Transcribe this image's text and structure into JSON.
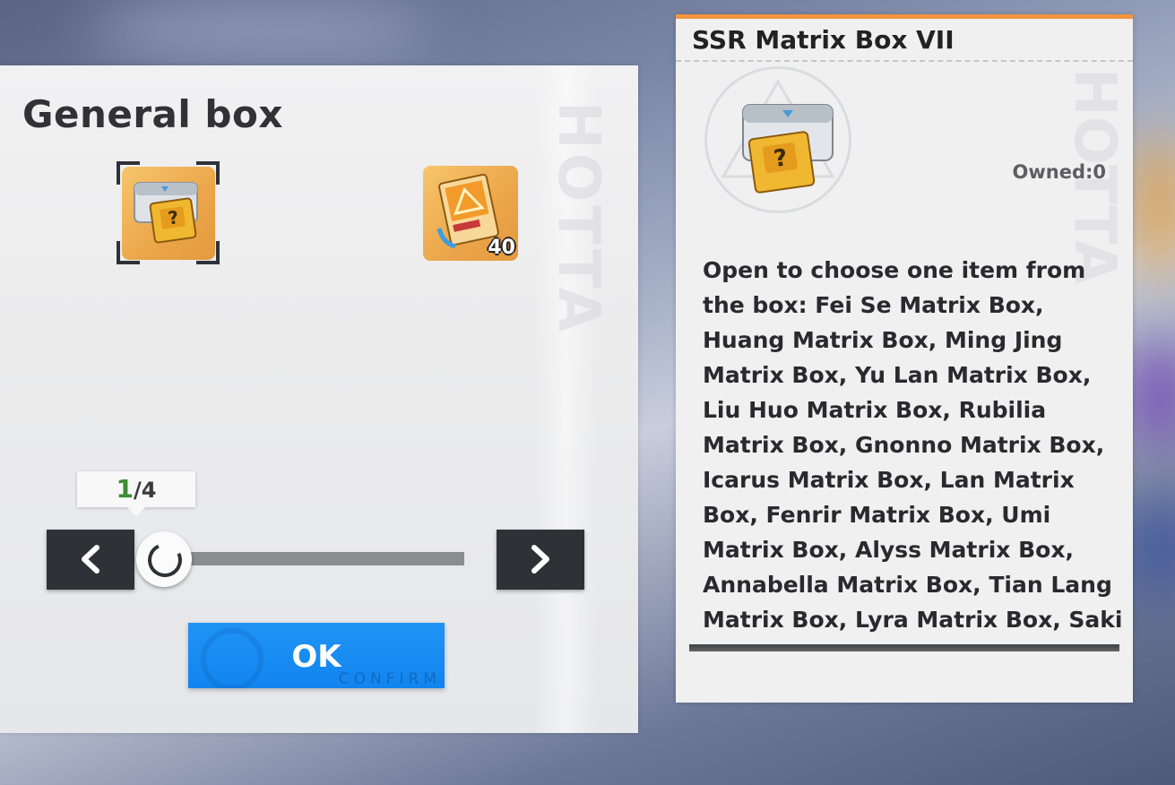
{
  "left_panel": {
    "title": "General box",
    "watermark": "HOTTA",
    "selected_item": {
      "icon": "ssr-matrix-box-icon"
    },
    "second_item": {
      "icon": "matrix-card-icon",
      "quantity": "40"
    },
    "pager": {
      "current": "1",
      "separator": "/",
      "total": "4",
      "progress": 0.25
    },
    "prev_label": "‹",
    "next_label": "›",
    "ok_label": "OK",
    "ok_sub": "CONFIRM"
  },
  "right_panel": {
    "title": "SSR Matrix Box VII",
    "owned": "Owned:0",
    "description": "Open to choose one item from the box: Fei Se Matrix Box, Huang Matrix Box, Ming Jing Matrix Box, Yu Lan Matrix Box, Liu Huo Matrix Box, Rubilia Matrix Box, Gnonno Matrix Box, Icarus Matrix Box, Lan Matrix Box, Fenrir Matrix Box, Umi Matrix Box, Alyss Matrix Box, Annabella Matrix Box, Tian Lang Matrix Box, Lyra Matrix Box, Saki Fuwa Matrix Box, Ruby Matrix Box, Frigg Matrix Box, Nemesis",
    "accent_color": "#f2953e"
  }
}
